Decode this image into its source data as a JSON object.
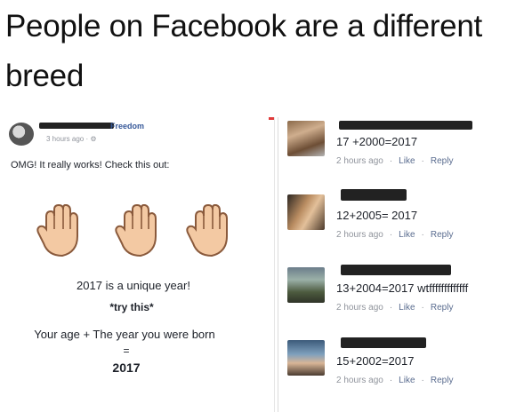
{
  "meme": {
    "title": "People on Facebook are a different breed"
  },
  "post": {
    "page_name": "Freedom",
    "time": "3 hours ago · ",
    "text": "OMG! It really works! Check this out:",
    "line1": "2017 is a unique year!",
    "line2": "*try this*",
    "line3": "Your age + The year you were born",
    "line4": "=",
    "line5": "2017",
    "hand_icon": "raised-hand-icon"
  },
  "comments": [
    {
      "text": "17 +2000=2017",
      "time": "2 hours ago",
      "like": "Like",
      "reply": "Reply"
    },
    {
      "text": "12+2005= 2017",
      "time": "2 hours ago",
      "like": "Like",
      "reply": "Reply"
    },
    {
      "text": "13+2004=2017 wtfffffffffffff",
      "time": "2 hours ago",
      "like": "Like",
      "reply": "Reply"
    },
    {
      "text": "15+2002=2017",
      "time": "2 hours ago",
      "like": "Like",
      "reply": "Reply"
    }
  ],
  "colors": {
    "link": "#365899",
    "meta": "#90949c",
    "hand_skin": "#f3c9a3",
    "hand_outline": "#8a5a3c"
  }
}
